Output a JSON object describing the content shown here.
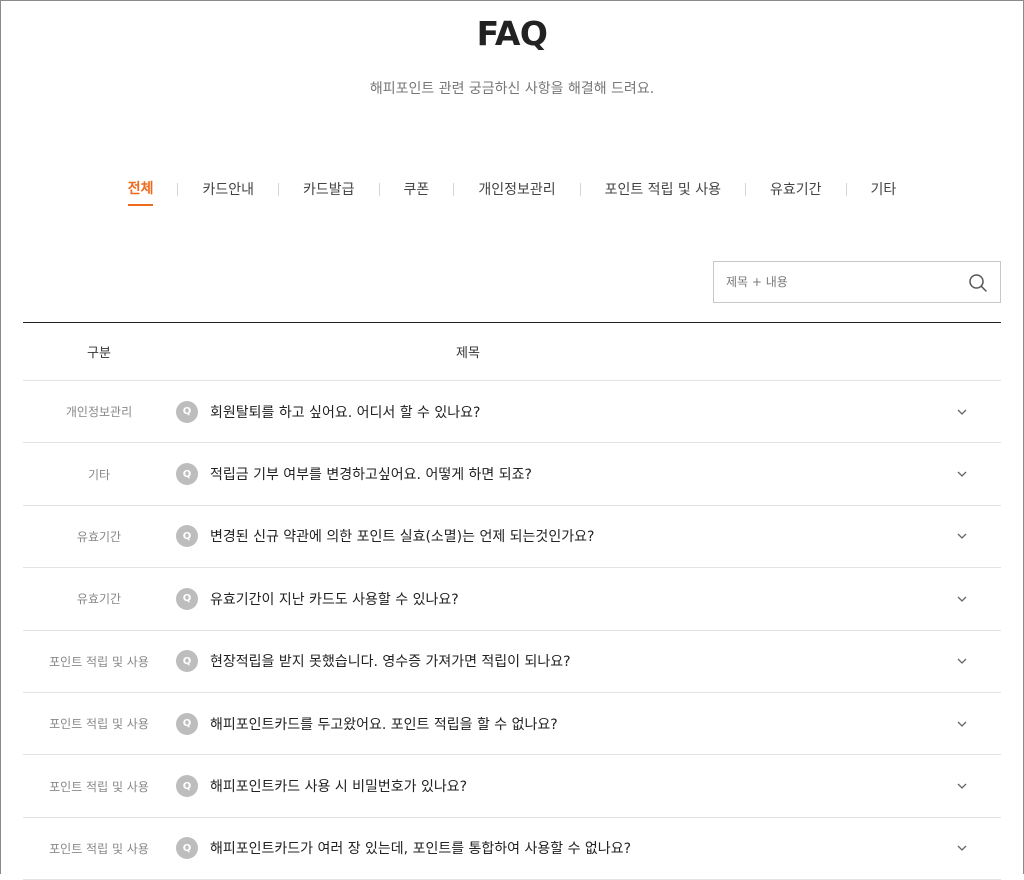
{
  "header": {
    "title": "FAQ",
    "subtitle": "해피포인트 관련 궁금하신 사항을 해결해 드려요."
  },
  "tabs": [
    {
      "label": "전체",
      "active": true
    },
    {
      "label": "카드안내",
      "active": false
    },
    {
      "label": "카드발급",
      "active": false
    },
    {
      "label": "쿠폰",
      "active": false
    },
    {
      "label": "개인정보관리",
      "active": false
    },
    {
      "label": "포인트 적립 및 사용",
      "active": false
    },
    {
      "label": "유효기간",
      "active": false
    },
    {
      "label": "기타",
      "active": false
    }
  ],
  "search": {
    "placeholder": "제목 + 내용",
    "value": "",
    "icon": "search-icon"
  },
  "table": {
    "headers": {
      "category": "구분",
      "title": "제목"
    },
    "badge": "Q",
    "rows": [
      {
        "category": "개인정보관리",
        "question": "회원탈퇴를 하고 싶어요. 어디서 할 수 있나요?"
      },
      {
        "category": "기타",
        "question": "적립금 기부 여부를 변경하고싶어요. 어떻게 하면 되죠?"
      },
      {
        "category": "유효기간",
        "question": "변경된 신규 약관에 의한 포인트 실효(소멸)는 언제 되는것인가요?"
      },
      {
        "category": "유효기간",
        "question": "유효기간이 지난 카드도 사용할 수 있나요?"
      },
      {
        "category": "포인트 적립 및 사용",
        "question": "현장적립을 받지 못했습니다. 영수증 가져가면 적립이 되나요?"
      },
      {
        "category": "포인트 적립 및 사용",
        "question": "해피포인트카드를 두고왔어요. 포인트 적립을 할 수 없나요?"
      },
      {
        "category": "포인트 적립 및 사용",
        "question": "해피포인트카드 사용 시 비밀번호가 있나요?"
      },
      {
        "category": "포인트 적립 및 사용",
        "question": "해피포인트카드가 여러 장 있는데, 포인트를 통합하여 사용할 수 없나요?"
      }
    ]
  },
  "colors": {
    "accent": "#ee6a1d",
    "badge": "#bdbdbd",
    "border": "#e3e3e3"
  }
}
